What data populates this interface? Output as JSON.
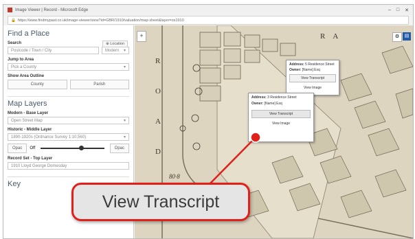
{
  "window": {
    "title": "Image Viewer | Record - Microsoft Edge",
    "url": "https://www.findmypast.co.uk/image-viewer/view?id=GBR/1910/valuation/map-sheet&layer=os1910"
  },
  "sidebar": {
    "find_place": {
      "heading": "Find a Place",
      "search_label": "Search",
      "location_button": "Location",
      "search_placeholder": "Postcode / Town / City",
      "search_mode": "Modern",
      "jump_label": "Jump to Area",
      "jump_value": "Pick a County",
      "show_area_label": "Show Area Outline",
      "county_button": "County",
      "parish_button": "Parish"
    },
    "map_layers": {
      "heading": "Map Layers",
      "base_label": "Modern - Base Layer",
      "base_value": "Open Street Map",
      "historic_label": "Historic - Middle Layer",
      "historic_value": "1890-1920s (Ordnance Survey 1:10,560)",
      "opacity_off": "Off",
      "opacity_on": "Opac",
      "record_label": "Record Set - Top Layer",
      "record_value": "1910 Lloyd George Domesday"
    },
    "key_heading": "Key"
  },
  "map": {
    "road_letters": [
      "R",
      "O",
      "A",
      "D"
    ],
    "corner_letters": [
      "R",
      "A"
    ],
    "spot_height": "80·8",
    "popup_back": {
      "address_label": "Address:",
      "address_value": "5 Residence Street",
      "owner_label": "Owner:",
      "owner_value": "[Name] Esq",
      "transcript_button": "View Transcript",
      "image_button": "View Image"
    },
    "popup_front": {
      "address_label": "Address:",
      "address_value": "3 Residence Street",
      "owner_label": "Owner:",
      "owner_value": "[Name] Esq",
      "transcript_button": "View Transcript",
      "image_button": "View Image"
    }
  },
  "callout": {
    "text": "View Transcript",
    "border_color": "#e0201b"
  }
}
